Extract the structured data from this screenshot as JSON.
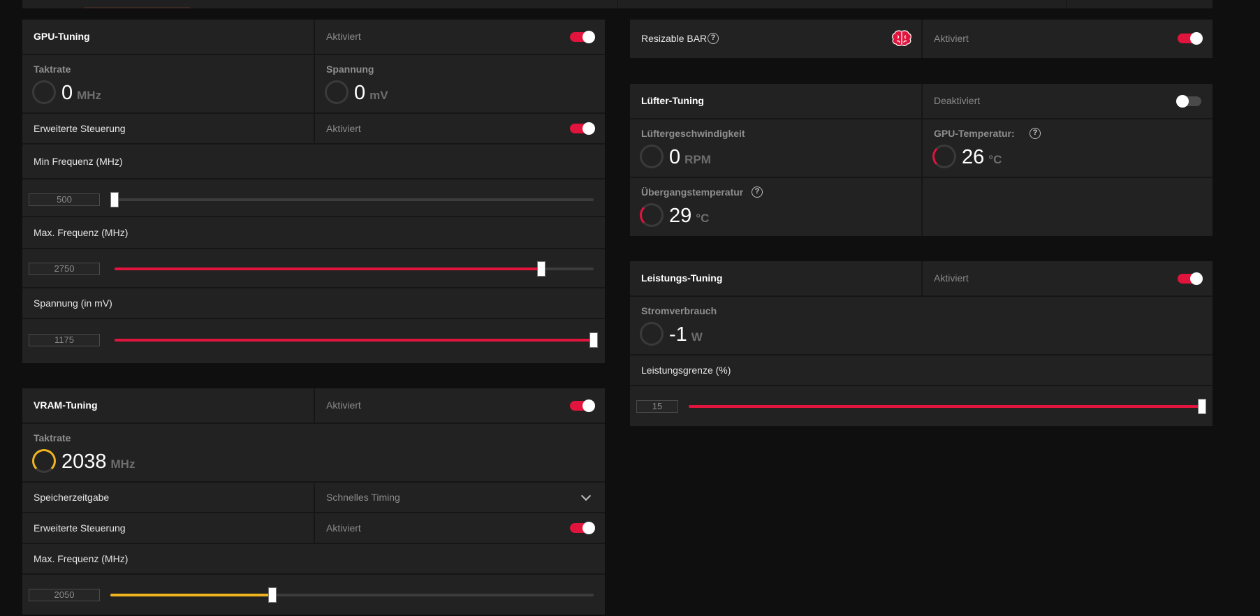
{
  "gpu_tuning": {
    "title": "GPU-Tuning",
    "state": "Aktiviert",
    "enabled": true,
    "clock": {
      "label": "Taktrate",
      "value": "0",
      "unit": "MHz"
    },
    "voltage": {
      "label": "Spannung",
      "value": "0",
      "unit": "mV"
    },
    "advanced": {
      "label": "Erweiterte Steuerung",
      "state": "Aktiviert",
      "enabled": true
    },
    "min_freq": {
      "label": "Min Frequenz (MHz)",
      "value": "500",
      "fraction": 0.0
    },
    "max_freq": {
      "label": "Max. Frequenz (MHz)",
      "value": "2750",
      "fraction": 0.89
    },
    "voltage_slider": {
      "label": "Spannung (in mV)",
      "value": "1175",
      "fraction": 1.0
    }
  },
  "vram_tuning": {
    "title": "VRAM-Tuning",
    "state": "Aktiviert",
    "enabled": true,
    "clock": {
      "label": "Taktrate",
      "value": "2038",
      "unit": "MHz"
    },
    "memory_timing": {
      "label": "Speicherzeitgabe",
      "value": "Schnelles Timing"
    },
    "advanced": {
      "label": "Erweiterte Steuerung",
      "state": "Aktiviert",
      "enabled": true
    },
    "max_freq": {
      "label": "Max. Frequenz (MHz)",
      "value": "2050",
      "fraction": 0.335
    }
  },
  "resizable_bar": {
    "label": "Resizable BAR",
    "help": "?",
    "state": "Aktiviert",
    "enabled": true,
    "icon": "brain-icon"
  },
  "fan_tuning": {
    "title": "Lüfter-Tuning",
    "state": "Deaktiviert",
    "enabled": false,
    "fan_speed": {
      "label": "Lüftergeschwindigkeit",
      "value": "0",
      "unit": "RPM"
    },
    "gpu_temp": {
      "label": "GPU-Temperatur:",
      "value": "26",
      "unit": "°C",
      "help": "?"
    },
    "junction_temp": {
      "label": "Übergangstemperatur",
      "value": "29",
      "unit": "°C",
      "help": "?"
    }
  },
  "power_tuning": {
    "title": "Leistungs-Tuning",
    "state": "Aktiviert",
    "enabled": true,
    "power_draw": {
      "label": "Stromverbrauch",
      "value": "-1",
      "unit": "W"
    },
    "power_limit": {
      "label": "Leistungsgrenze (%)",
      "value": "15",
      "fraction": 1.0
    }
  },
  "colors": {
    "accent_red": "#e0143c",
    "accent_yellow": "#f0b41e",
    "panel_bg": "#222222",
    "page_bg": "#0f0f0f"
  }
}
